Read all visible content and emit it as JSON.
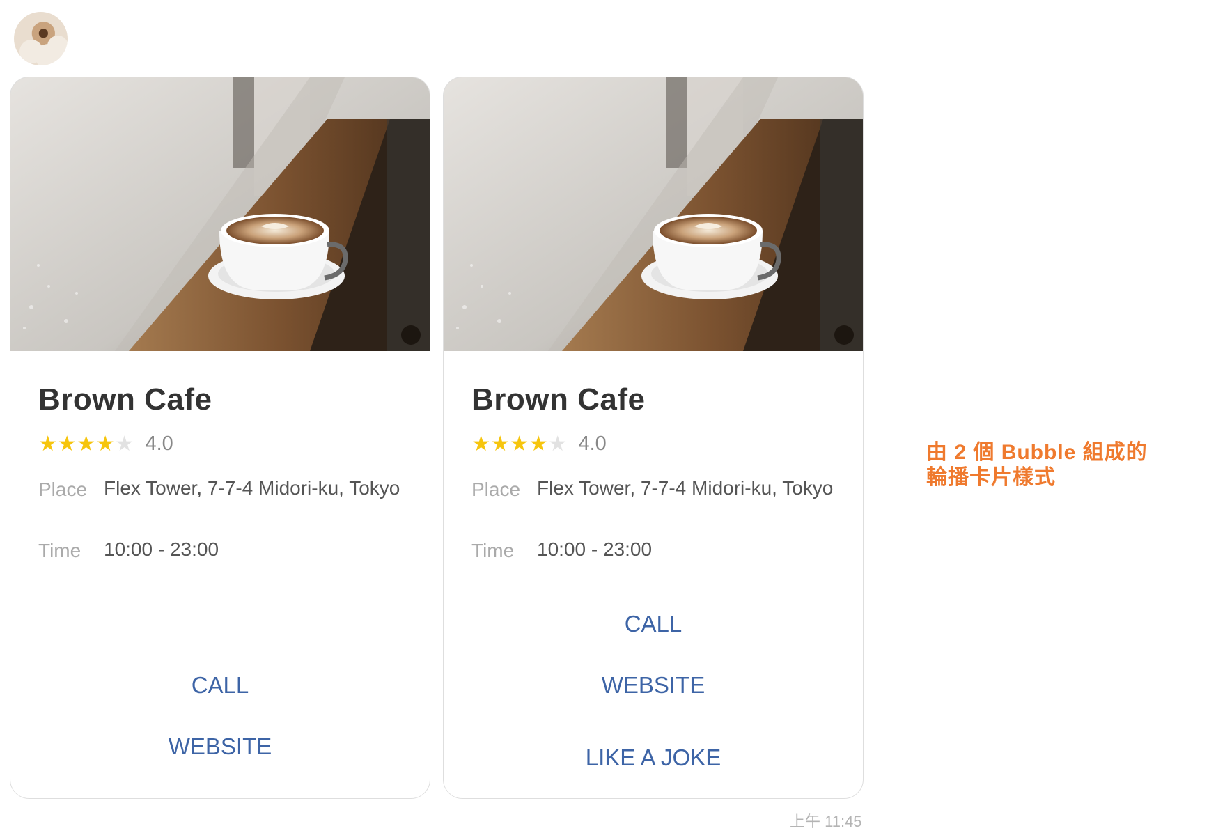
{
  "chat": {
    "avatar_icon": "sender-avatar",
    "timestamp": "上午 11:45"
  },
  "carousel": {
    "cards": [
      {
        "image_icon": "coffee-latte-photo",
        "title": "Brown Cafe",
        "rating": 4,
        "rating_max": 5,
        "rating_label": "4.0",
        "place_label": "Place",
        "place_value": "Flex Tower, 7-7-4 Midori-ku, Tokyo",
        "time_label": "Time",
        "time_value": "10:00 - 23:00",
        "actions": [
          "CALL",
          "WEBSITE"
        ]
      },
      {
        "image_icon": "coffee-latte-photo",
        "title": "Brown Cafe",
        "rating": 4,
        "rating_max": 5,
        "rating_label": "4.0",
        "place_label": "Place",
        "place_value": "Flex Tower, 7-7-4 Midori-ku, Tokyo",
        "time_label": "Time",
        "time_value": "10:00 - 23:00",
        "actions": [
          "CALL",
          "WEBSITE",
          "LIKE A JOKE"
        ]
      }
    ]
  },
  "annotation": {
    "line1": "由 2 個 Bubble 組成的",
    "line2": "輪播卡片樣式"
  },
  "colors": {
    "star_on": "#f6c50e",
    "star_off": "#e2e2e2",
    "action": "#3d64a6",
    "annotation": "#ef7a2e"
  }
}
